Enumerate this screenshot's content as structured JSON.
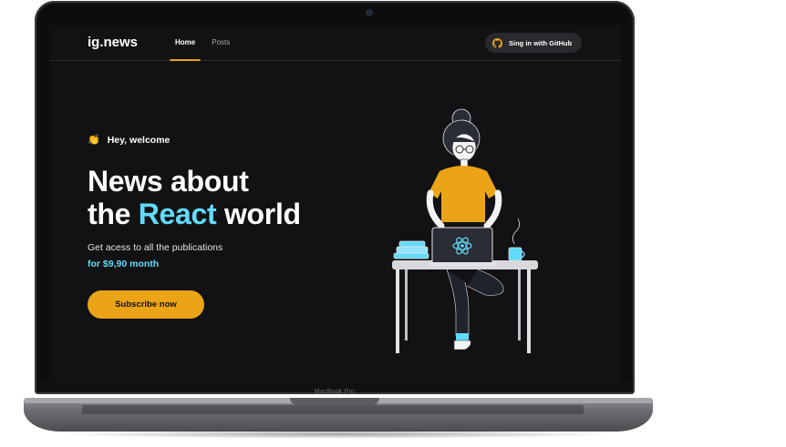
{
  "device": {
    "model_label": "MacBook Pro"
  },
  "header": {
    "logo": "ig.news",
    "nav": [
      {
        "label": "Home",
        "active": true
      },
      {
        "label": "Posts",
        "active": false
      }
    ],
    "signin_label": "Sing in with GitHub",
    "signin_icon": "github-icon"
  },
  "hero": {
    "welcome_icon": "clapping-hands",
    "welcome_text": "Hey, welcome",
    "headline_part1": "News about",
    "headline_part2": "the",
    "headline_accent": "React",
    "headline_part3": "world",
    "subtitle": "Get acess to all the publications",
    "price": "for $9,90 month",
    "subscribe_label": "Subscribe now"
  },
  "colors": {
    "background": "#121214",
    "accent_yellow": "#eba417",
    "accent_cyan": "#61dafb",
    "header_border": "#29292e"
  }
}
